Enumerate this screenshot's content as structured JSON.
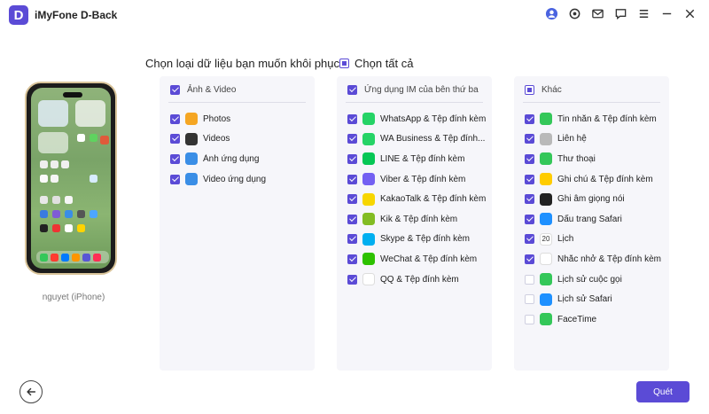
{
  "app": {
    "logo_letter": "D",
    "title": "iMyFone D-Back"
  },
  "titlebar_icons": [
    "account-icon",
    "settings-icon",
    "mail-icon",
    "feedback-icon",
    "menu-icon",
    "minimize-icon",
    "close-icon"
  ],
  "device": {
    "name": "nguyet (iPhone)"
  },
  "header": {
    "prompt": "Chọn loại dữ liệu bạn muốn khôi phục.",
    "select_all": "Chọn tất cả",
    "select_all_state": "partial"
  },
  "panels": [
    {
      "title": "Ảnh & Video",
      "state": "checked",
      "items": [
        {
          "label": "Photos",
          "checked": true,
          "icon": "photos-icon",
          "color": "#f5a623"
        },
        {
          "label": "Videos",
          "checked": true,
          "icon": "videos-icon",
          "color": "#333333"
        },
        {
          "label": "Ảnh ứng dụng",
          "checked": true,
          "icon": "app-photos-icon",
          "color": "#3a8ee6"
        },
        {
          "label": "Video ứng dụng",
          "checked": true,
          "icon": "app-videos-icon",
          "color": "#3a8ee6"
        }
      ]
    },
    {
      "title": "Ứng dụng IM của bên thứ ba",
      "state": "checked",
      "items": [
        {
          "label": "WhatsApp & Tệp đính kèm",
          "checked": true,
          "icon": "whatsapp-icon",
          "color": "#25d366"
        },
        {
          "label": "WA Business & Tệp đính...",
          "checked": true,
          "icon": "wa-business-icon",
          "color": "#25d366"
        },
        {
          "label": "LINE & Tệp đính kèm",
          "checked": true,
          "icon": "line-icon",
          "color": "#06c755"
        },
        {
          "label": "Viber & Tệp đính kèm",
          "checked": true,
          "icon": "viber-icon",
          "color": "#7360f2"
        },
        {
          "label": "KakaoTalk & Tệp đính kèm",
          "checked": true,
          "icon": "kakaotalk-icon",
          "color": "#f7d600"
        },
        {
          "label": "Kik & Tệp đính kèm",
          "checked": true,
          "icon": "kik-icon",
          "color": "#82bc23"
        },
        {
          "label": "Skype & Tệp đính kèm",
          "checked": true,
          "icon": "skype-icon",
          "color": "#00aff0"
        },
        {
          "label": "WeChat & Tệp đính kèm",
          "checked": true,
          "icon": "wechat-icon",
          "color": "#2dc100"
        },
        {
          "label": "QQ & Tệp đính kèm",
          "checked": true,
          "icon": "qq-icon",
          "color": "#ffffff"
        }
      ]
    },
    {
      "title": "Khác",
      "state": "partial",
      "items": [
        {
          "label": "Tin nhắn & Tệp đính kèm",
          "checked": true,
          "icon": "messages-icon",
          "color": "#34c759"
        },
        {
          "label": "Liên hệ",
          "checked": true,
          "icon": "contacts-icon",
          "color": "#b9b9b9"
        },
        {
          "label": "Thư thoại",
          "checked": true,
          "icon": "voicemail-icon",
          "color": "#34c759"
        },
        {
          "label": "Ghi chú & Tệp đính kèm",
          "checked": true,
          "icon": "notes-icon",
          "color": "#ffcc00"
        },
        {
          "label": "Ghi âm giọng nói",
          "checked": true,
          "icon": "voice-memos-icon",
          "color": "#222222"
        },
        {
          "label": "Dấu trang Safari",
          "checked": true,
          "icon": "safari-bookmarks-icon",
          "color": "#1e90ff"
        },
        {
          "label": "Lịch",
          "checked": true,
          "icon": "calendar-icon",
          "color": "#ffffff",
          "icon_text": "20"
        },
        {
          "label": "Nhắc nhở & Tệp đính kèm",
          "checked": true,
          "icon": "reminders-icon",
          "color": "#ffffff"
        },
        {
          "label": "Lịch sử cuộc gọi",
          "checked": false,
          "icon": "call-history-icon",
          "color": "#34c759"
        },
        {
          "label": "Lịch sử Safari",
          "checked": false,
          "icon": "safari-history-icon",
          "color": "#1e90ff"
        },
        {
          "label": "FaceTime",
          "checked": false,
          "icon": "facetime-icon",
          "color": "#34c759"
        }
      ]
    }
  ],
  "footer": {
    "back_icon": "back-arrow-icon",
    "scan_label": "Quét"
  },
  "colors": {
    "accent": "#5b4bd6",
    "panel_bg": "#f6f6fa"
  }
}
